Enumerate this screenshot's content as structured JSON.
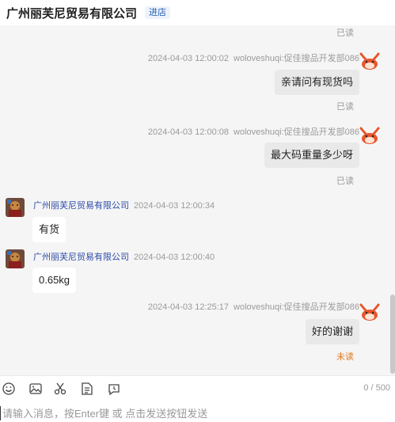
{
  "header": {
    "shop_name": "广州丽芙尼贸易有限公司",
    "enter_shop_label": "进店"
  },
  "messages": [
    {
      "type": "status",
      "text": "已读"
    },
    {
      "type": "outgoing",
      "time": "2024-04-03 12:00:02",
      "sender": "woloveshuqi:促佳搜品开发部086",
      "text": "亲请问有现货吗",
      "status": "已读"
    },
    {
      "type": "outgoing",
      "time": "2024-04-03 12:00:08",
      "sender": "woloveshuqi:促佳搜品开发部086",
      "text": "最大码重量多少呀",
      "status": "已读"
    },
    {
      "type": "incoming",
      "sender": "广州丽芙尼贸易有限公司",
      "time": "2024-04-03 12:00:34",
      "text": "有货"
    },
    {
      "type": "incoming",
      "sender": "广州丽芙尼贸易有限公司",
      "time": "2024-04-03 12:00:40",
      "text": "0.65kg"
    },
    {
      "type": "outgoing",
      "time": "2024-04-03 12:25:17",
      "sender": "woloveshuqi:促佳搜品开发部086",
      "text": "好的谢谢",
      "status": "未读"
    }
  ],
  "toolbar": {
    "icons": [
      "emoji-icon",
      "image-icon",
      "scissors-icon",
      "document-icon",
      "history-icon"
    ],
    "char_count": "0 / 500"
  },
  "input": {
    "placeholder": "请输入消息，按Enter键 或 点击发送按钮发送"
  },
  "colors": {
    "background": "#f5f5f5",
    "incoming_name": "#2b4aa8",
    "unread": "#e07a1f",
    "bubble_out": "#e9e9e9"
  }
}
